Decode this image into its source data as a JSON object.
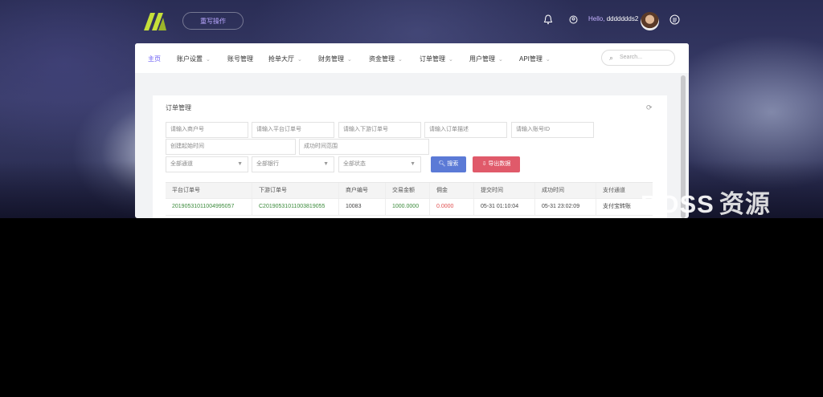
{
  "header": {
    "top_button_label": "重写操作",
    "hello_prefix": "Hello,",
    "username": "ddddddds2",
    "icons": [
      "bell-icon",
      "refresh-user-icon",
      "menu-icon"
    ],
    "brand_color": "#c6e03a",
    "accent_color": "#6a5cf5"
  },
  "nav": {
    "items": [
      {
        "label": "主页",
        "active": true,
        "has_chevron": false
      },
      {
        "label": "账户设置",
        "has_chevron": true
      },
      {
        "label": "账号管理",
        "has_chevron": false
      },
      {
        "label": "抢单大厅",
        "has_chevron": true
      },
      {
        "label": "财务管理",
        "has_chevron": true
      },
      {
        "label": "资金管理",
        "has_chevron": true
      },
      {
        "label": "订单管理",
        "has_chevron": true
      },
      {
        "label": "用户管理",
        "has_chevron": true
      },
      {
        "label": "API管理",
        "has_chevron": true
      }
    ],
    "search_placeholder": "Search..."
  },
  "card": {
    "title": "订单管理",
    "filters": {
      "merchant_no": "请输入商户号",
      "platform_order_no": "请输入平台订单号",
      "downstream_order_no": "请输入下游订单号",
      "order_desc": "请输入订单描述",
      "account_id": "请输入账号ID",
      "created_range": "创建起始时间",
      "success_range": "成功时间范围",
      "channel": "全部通道",
      "bank": "全部银行",
      "status": "全部状态"
    },
    "buttons": {
      "search": "搜索",
      "export": "导出数据"
    }
  },
  "table": {
    "columns": [
      "平台订单号",
      "下游订单号",
      "商户编号",
      "交易金额",
      "佣金",
      "提交时间",
      "成功时间",
      "支付通道"
    ],
    "rows": [
      [
        "20190531011004995057",
        "C20190531011003819055",
        "10083",
        "1000.0000",
        "0.0000",
        "05-31 01:10:04",
        "05-31 23:02:09",
        "支付宝转账"
      ]
    ]
  },
  "watermark": {
    "latin": "BOSS",
    "cn": "资源"
  }
}
